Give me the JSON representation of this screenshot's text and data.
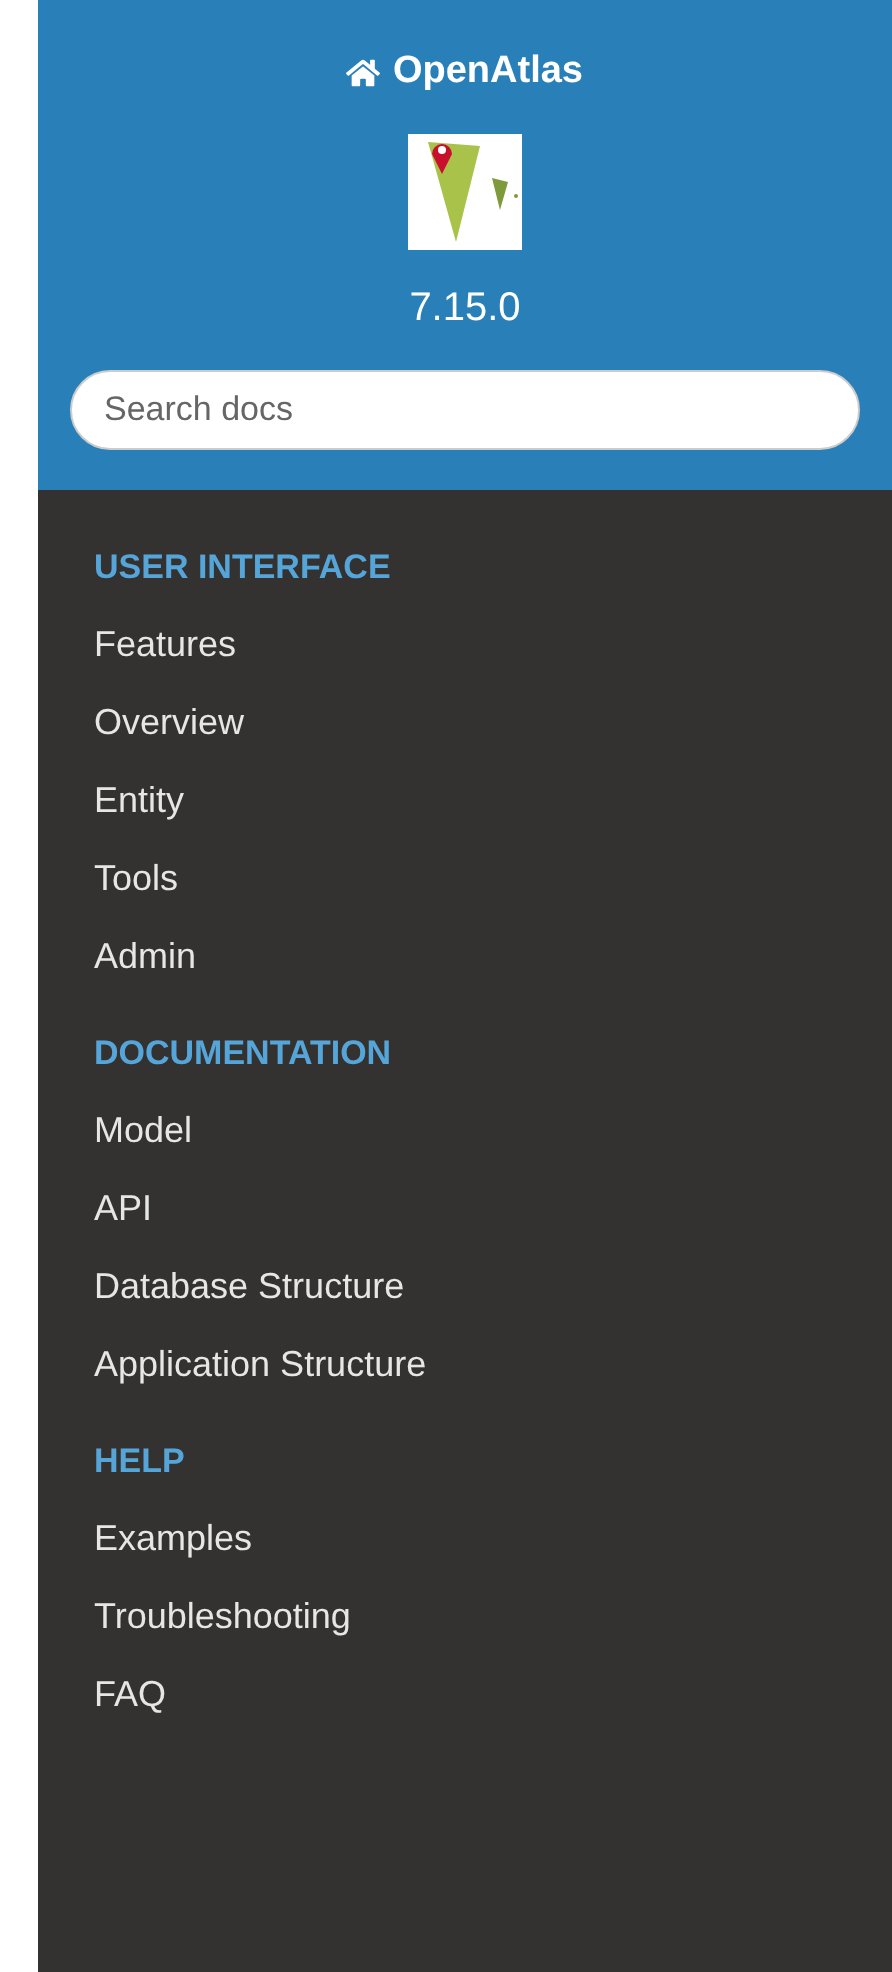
{
  "header": {
    "title": "OpenAtlas",
    "version": "7.15.0",
    "search": {
      "placeholder": "Search docs"
    }
  },
  "sections": [
    {
      "heading": "USER INTERFACE",
      "items": [
        "Features",
        "Overview",
        "Entity",
        "Tools",
        "Admin"
      ]
    },
    {
      "heading": "DOCUMENTATION",
      "items": [
        "Model",
        "API",
        "Database Structure",
        "Application Structure"
      ]
    },
    {
      "heading": "HELP",
      "items": [
        "Examples",
        "Troubleshooting",
        "FAQ"
      ]
    }
  ]
}
